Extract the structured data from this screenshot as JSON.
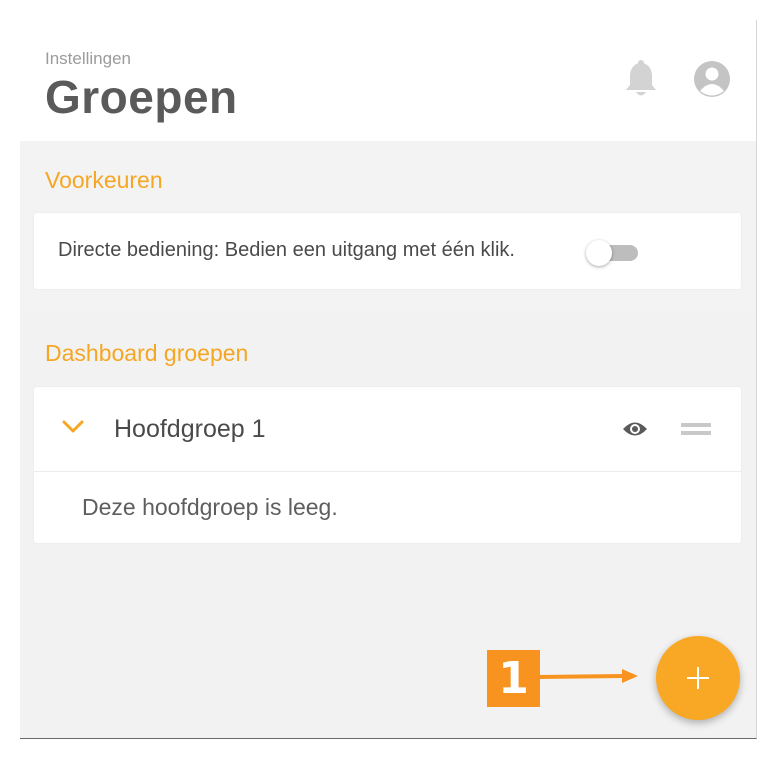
{
  "header": {
    "breadcrumb": "Instellingen",
    "title": "Groepen",
    "bell_icon": "bell-icon",
    "avatar_icon": "user-avatar-icon"
  },
  "preferences": {
    "title": "Voorkeuren",
    "direct_control_label": "Directe bediening: Bedien een uitgang met één klik.",
    "direct_control_enabled": false
  },
  "dashboard": {
    "title": "Dashboard groepen",
    "groups": [
      {
        "name": "Hoofdgroep 1",
        "expanded": true,
        "empty_message": "Deze hoofdgroep is leeg."
      }
    ]
  },
  "fab": {
    "icon": "plus-icon"
  },
  "annotation": {
    "number": "1"
  },
  "colors": {
    "accent": "#f5a623",
    "fab": "#f9a825",
    "annotation": "#f7931e",
    "toggle_off": "#bdbdbd",
    "title": "#5a5a5a"
  }
}
